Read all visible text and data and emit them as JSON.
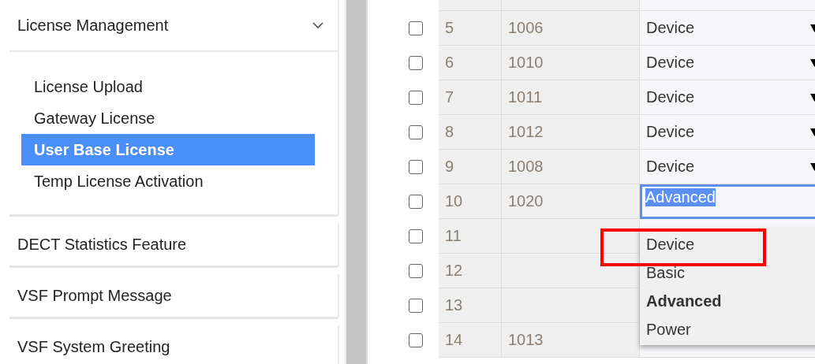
{
  "sidebar": {
    "sections": [
      {
        "title": "License Management",
        "expanded": true,
        "items": [
          {
            "label": "License Upload",
            "selected": false
          },
          {
            "label": "Gateway License",
            "selected": false
          },
          {
            "label": "User Base License",
            "selected": true
          },
          {
            "label": "Temp License Activation",
            "selected": false
          }
        ]
      },
      {
        "title": "DECT Statistics Feature"
      },
      {
        "title": "VSF Prompt Message"
      },
      {
        "title": "VSF System Greeting"
      }
    ]
  },
  "table": {
    "rows": [
      {
        "checked": false,
        "index": "5",
        "extension": "1006",
        "type": "Device"
      },
      {
        "checked": false,
        "index": "6",
        "extension": "1010",
        "type": "Device"
      },
      {
        "checked": false,
        "index": "7",
        "extension": "1011",
        "type": "Device"
      },
      {
        "checked": false,
        "index": "8",
        "extension": "1012",
        "type": "Device"
      },
      {
        "checked": false,
        "index": "9",
        "extension": "1008",
        "type": "Device"
      },
      {
        "checked": false,
        "index": "10",
        "extension": "1020",
        "type": "Advanced",
        "editing": true
      },
      {
        "checked": false,
        "index": "11"
      },
      {
        "checked": false,
        "index": "12"
      },
      {
        "checked": false,
        "index": "13"
      },
      {
        "checked": false,
        "index": "14",
        "extension": "1013"
      }
    ]
  },
  "dropdown": {
    "options": [
      {
        "label": "Device",
        "selected": false,
        "highlighted": true
      },
      {
        "label": "Basic",
        "selected": false,
        "highlighted": false
      },
      {
        "label": "Advanced",
        "selected": true,
        "highlighted": false
      },
      {
        "label": "Power",
        "selected": false,
        "highlighted": false
      }
    ]
  }
}
